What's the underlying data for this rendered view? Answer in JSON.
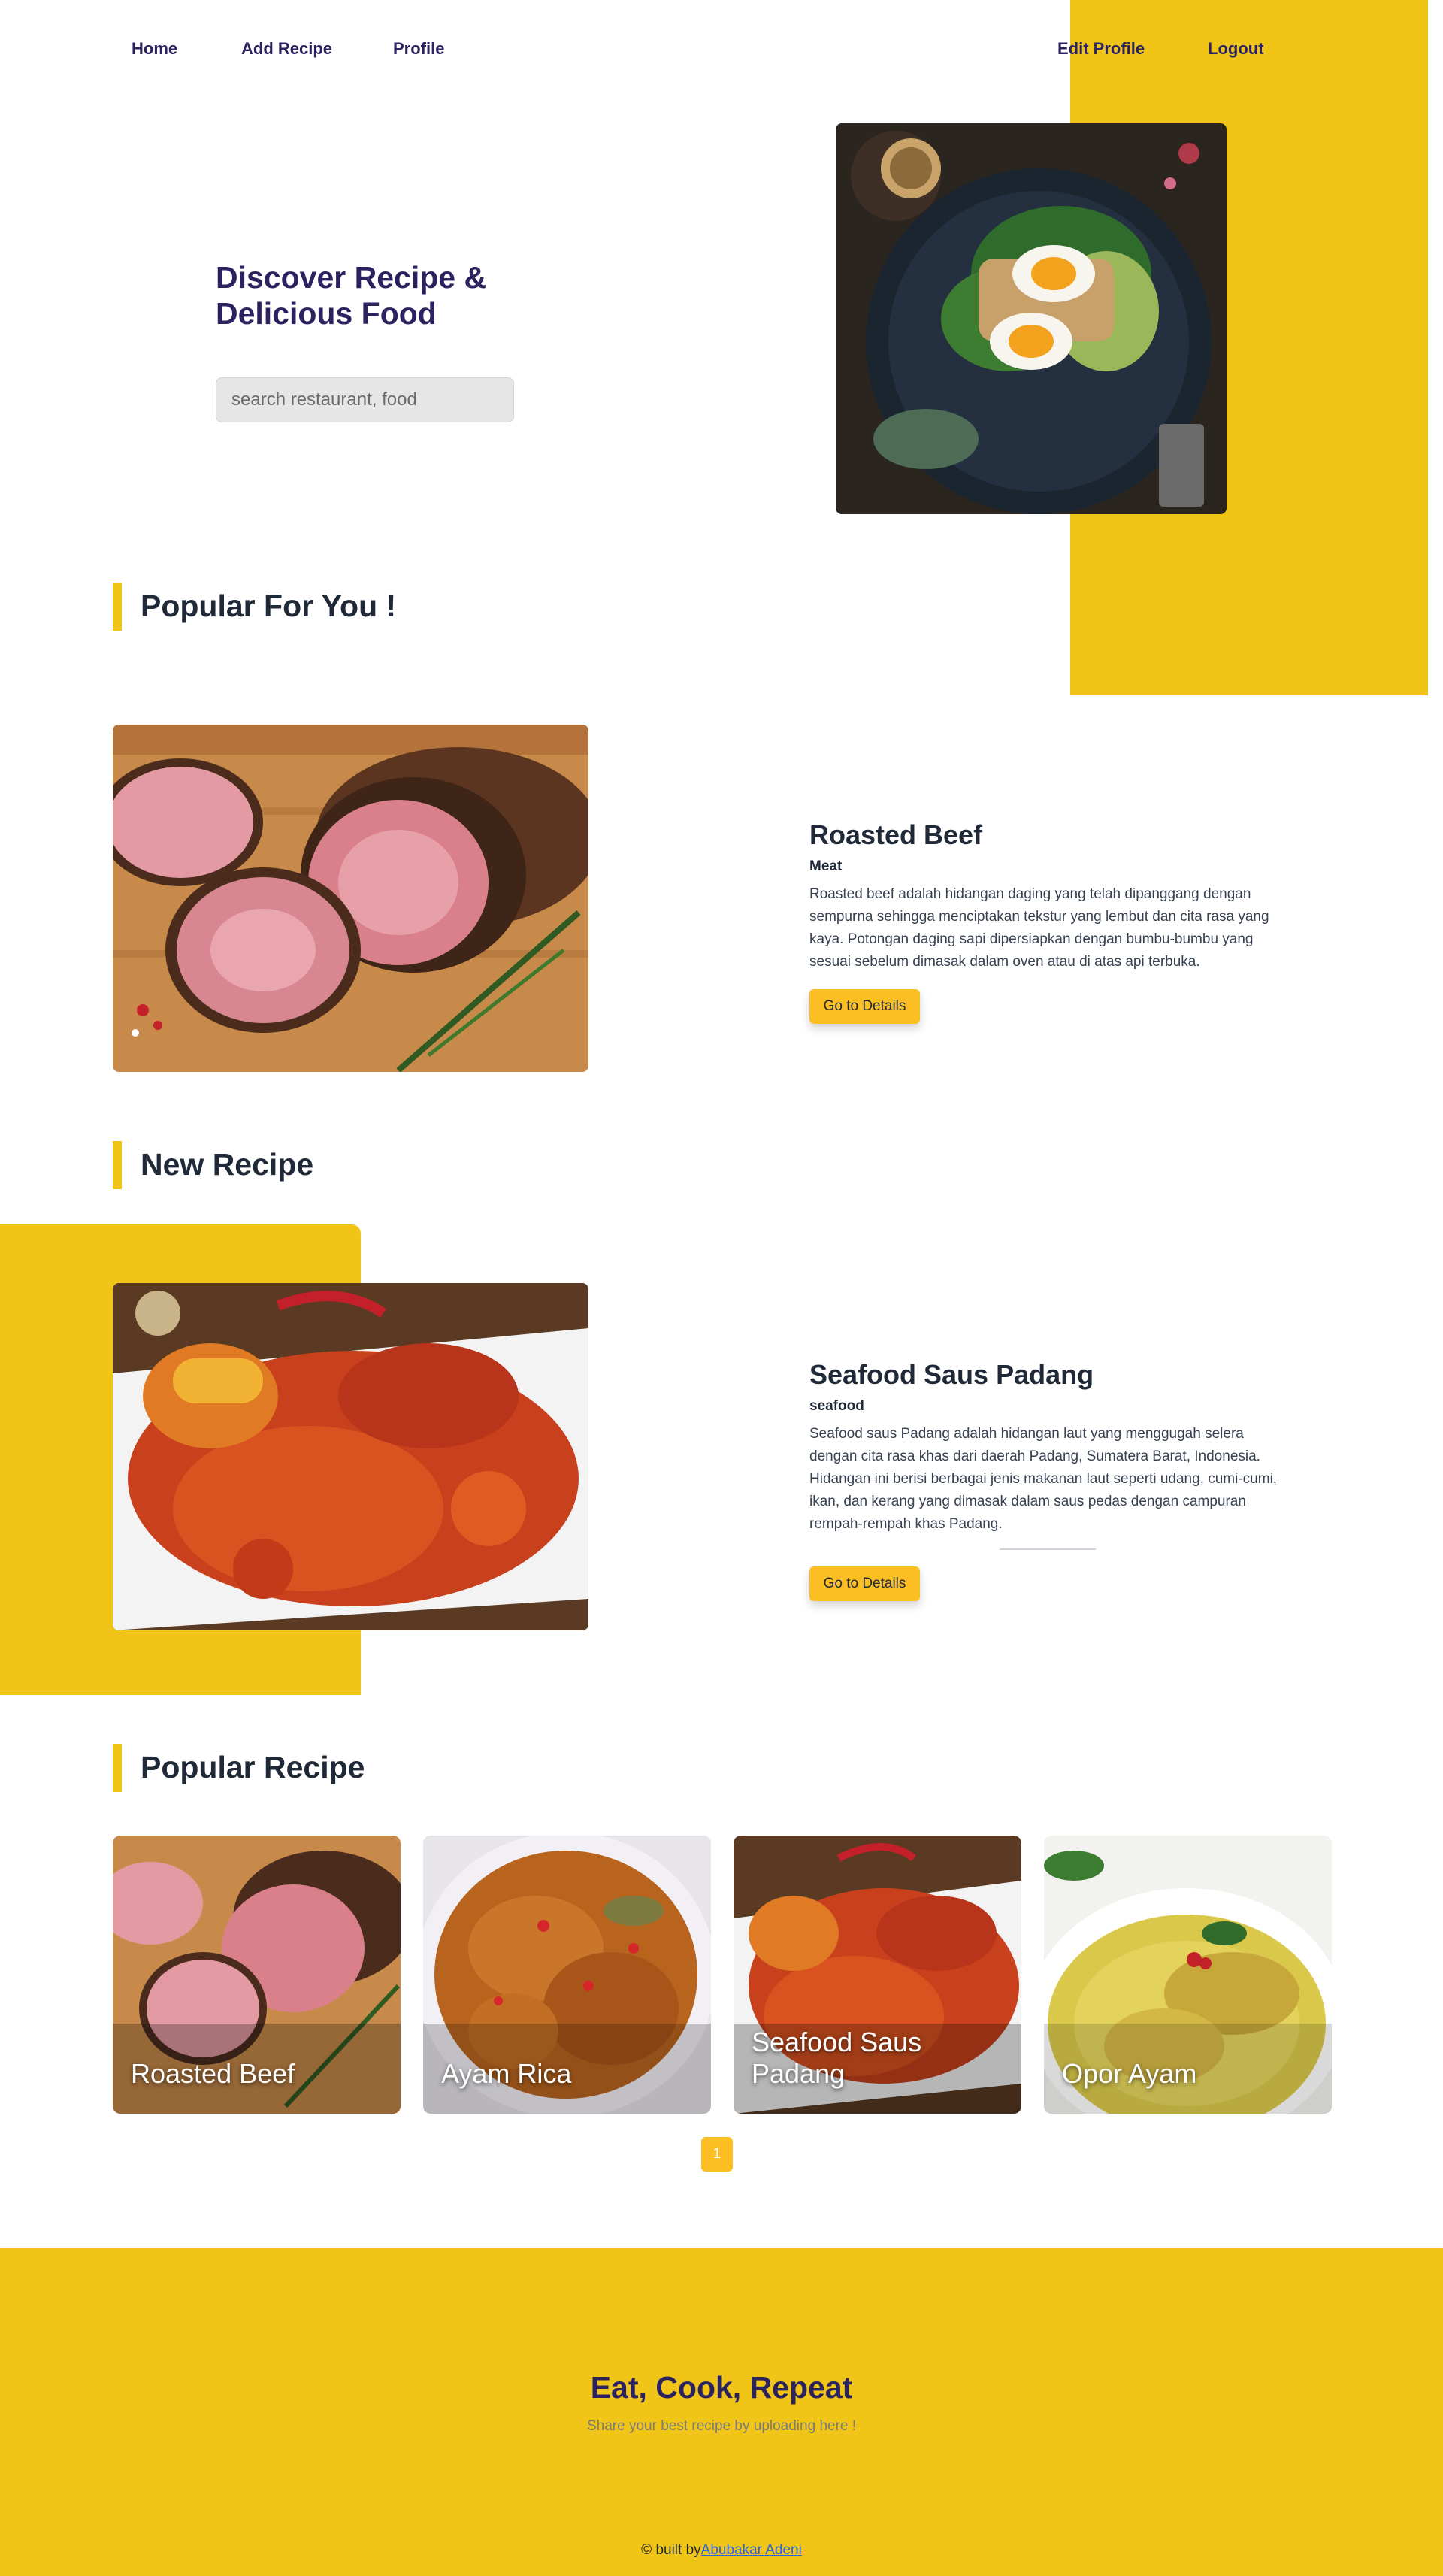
{
  "nav": {
    "home": "Home",
    "add_recipe": "Add Recipe",
    "profile": "Profile",
    "edit_profile": "Edit Profile",
    "logout": "Logout"
  },
  "hero": {
    "title": "Discover Recipe & Delicious Food",
    "search_placeholder": "search restaurant, food",
    "image_icon": "egg-toast-plate-image"
  },
  "popular_for_you": {
    "heading": "Popular For You !",
    "recipe": {
      "title": "Roasted Beef",
      "category": "Meat",
      "description": "Roasted beef adalah hidangan daging yang telah dipanggang dengan sempurna sehingga menciptakan tekstur yang lembut dan cita rasa yang kaya. Potongan daging sapi dipersiapkan dengan bumbu-bumbu yang sesuai sebelum dimasak dalam oven atau di atas api terbuka.",
      "button": "Go to Details"
    }
  },
  "new_recipe": {
    "heading": "New Recipe",
    "recipe": {
      "title": "Seafood Saus Padang",
      "category": "seafood",
      "description": "Seafood saus Padang adalah hidangan laut yang menggugah selera dengan cita rasa khas dari daerah Padang, Sumatera Barat, Indonesia. Hidangan ini berisi berbagai jenis makanan laut seperti udang, cumi-cumi, ikan, dan kerang yang dimasak dalam saus pedas dengan campuran rempah-rempah khas Padang.",
      "button": "Go to Details"
    }
  },
  "popular_recipe": {
    "heading": "Popular Recipe",
    "cards": [
      {
        "label": "Roasted Beef"
      },
      {
        "label": "Ayam Rica"
      },
      {
        "label": "Seafood Saus Padang"
      },
      {
        "label": "Opor Ayam"
      }
    ],
    "pagination": [
      "1"
    ]
  },
  "footer": {
    "title": "Eat, Cook, Repeat",
    "subtitle": "Share your best recipe by uploading here !",
    "credit_prefix": "© built by",
    "credit_author": "Abubakar Adeni"
  },
  "colors": {
    "accent_yellow": "#f1c517",
    "button_yellow": "#fbbf24",
    "nav_text": "#2a2360"
  }
}
